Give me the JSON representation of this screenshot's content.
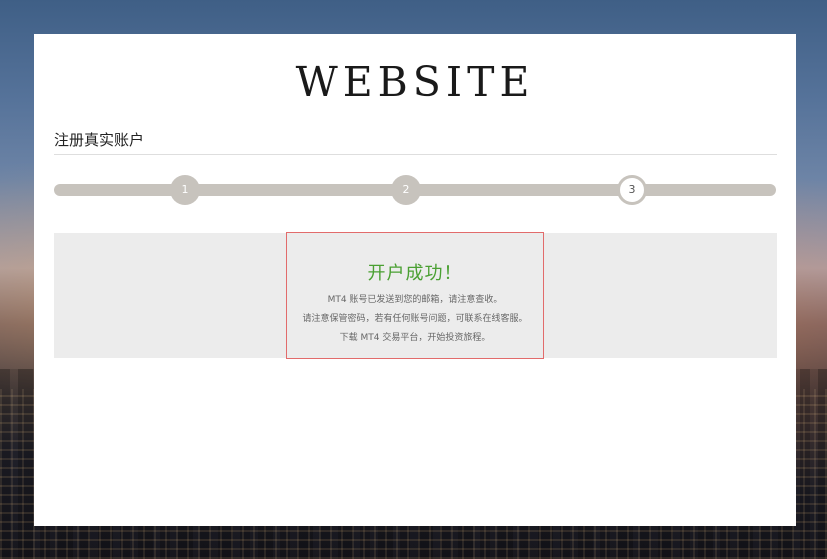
{
  "brand": {
    "logo_text": "WEBSITE"
  },
  "page": {
    "title": "注册真实账户"
  },
  "progress": {
    "steps": [
      {
        "label": "1",
        "state": "done"
      },
      {
        "label": "2",
        "state": "done"
      },
      {
        "label": "3",
        "state": "current"
      }
    ],
    "colors": {
      "track": "#c7c3bd"
    }
  },
  "result": {
    "title": "开户成功！",
    "lines": [
      "MT4 账号已发送到您的邮箱，请注意查收。",
      "请注意保管密码，若有任何账号问题，可联系在线客服。",
      "下载 MT4 交易平台，开始投资旅程。"
    ],
    "colors": {
      "success": "#4aa032",
      "border": "#e26b6b"
    }
  }
}
